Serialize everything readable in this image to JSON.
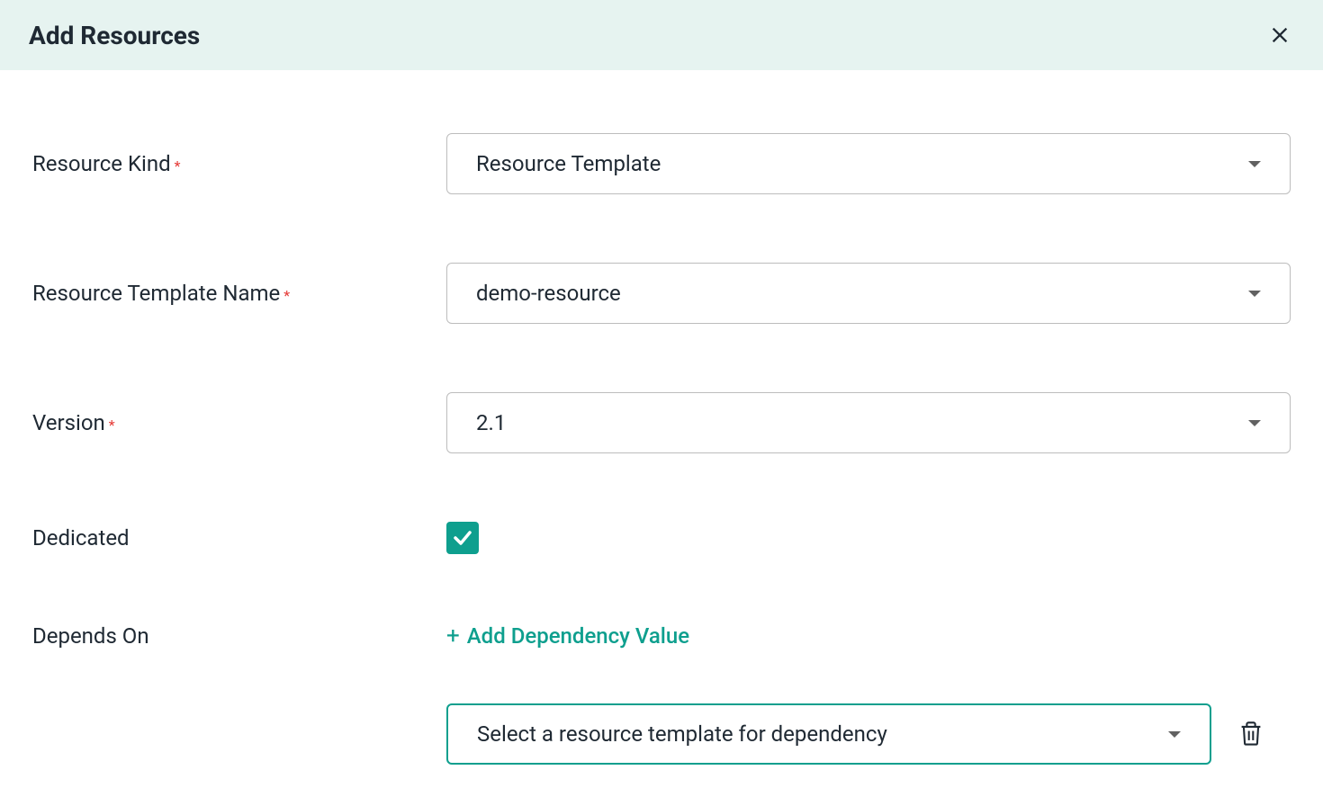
{
  "header": {
    "title": "Add Resources"
  },
  "form": {
    "resource_kind": {
      "label": "Resource Kind",
      "required": "*",
      "value": "Resource Template"
    },
    "resource_template_name": {
      "label": "Resource Template Name",
      "required": "*",
      "value": "demo-resource"
    },
    "version": {
      "label": "Version",
      "required": "*",
      "value": "2.1"
    },
    "dedicated": {
      "label": "Dedicated",
      "checked": true
    },
    "depends_on": {
      "label": "Depends On",
      "add_link": "Add Dependency Value",
      "dependency_placeholder": "Select a resource template for dependency"
    }
  }
}
